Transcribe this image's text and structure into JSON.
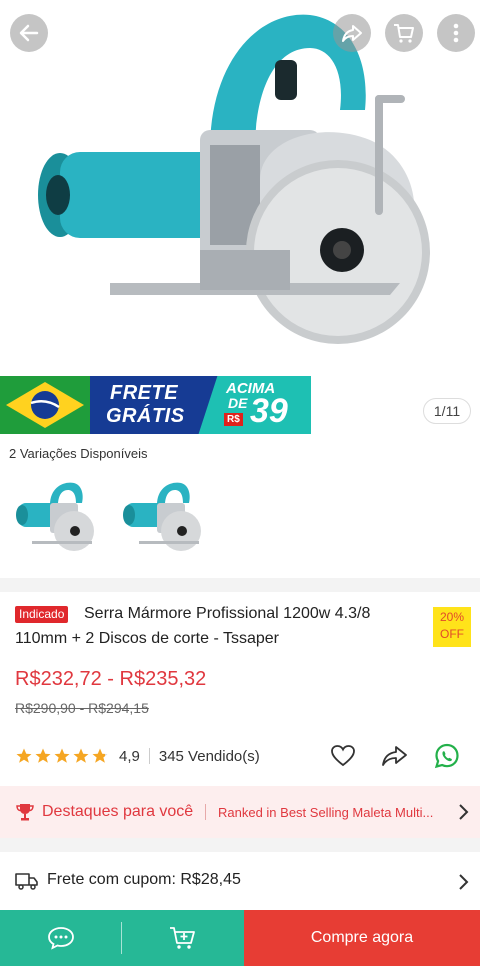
{
  "gallery": {
    "pager": "1/11",
    "banner": {
      "line1": "FRETE",
      "line2": "GRÁTIS",
      "acima": "ACIMA",
      "de": "DE",
      "currency": "R$",
      "amount": "39"
    }
  },
  "variations": {
    "label": "2 Variações Disponíveis"
  },
  "product": {
    "badge": "Indicado",
    "title_line1": "Serra Mármore Profissional 1200w 4.3/8",
    "title_line2": "110mm + 2 Discos de corte - Tssaper",
    "discount_percent": "20%",
    "discount_label": "OFF",
    "price": "R$232,72 - R$235,32",
    "old_price": "R$290,90 - R$294,15",
    "rating": "4,9",
    "rating_stars": 4.9,
    "sold": "345 Vendido(s)"
  },
  "highlights": {
    "title": "Destaques para você",
    "detail": "Ranked in Best Selling Maleta Multi..."
  },
  "shipping": {
    "text": "Frete com cupom: R$28,45"
  },
  "bottom_bar": {
    "buy_label": "Compre agora"
  },
  "colors": {
    "accent_red": "#e0383f",
    "teal": "#26b896",
    "buy_red": "#e73d34"
  },
  "icons": [
    "back-arrow-icon",
    "share-icon",
    "cart-icon",
    "more-icon",
    "heart-icon",
    "forward-icon",
    "whatsapp-icon",
    "trophy-icon",
    "truck-icon",
    "chat-icon",
    "add-cart-icon"
  ]
}
